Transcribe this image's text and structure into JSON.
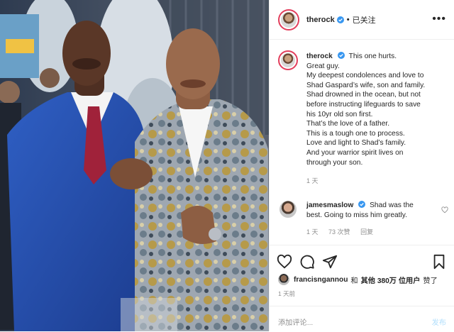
{
  "post": {
    "author": {
      "username": "therock",
      "follow_label": "已关注",
      "separator": "•",
      "verified_icon": "verified-badge-icon",
      "more_icon": "more-options-icon",
      "more_glyph": "•••"
    },
    "photo": {
      "alt_icon": "post-photo"
    },
    "caption": {
      "username": "therock",
      "lines": [
        "This one hurts.",
        "Great guy.",
        "My deepest condolences and love to",
        "Shad Gaspard’s wife, son and family.",
        "Shad drowned in the ocean, but not",
        "before instructing lifeguards to save",
        "his 10yr old son first.",
        "That’s the love of a father.",
        "This is a tough one to process.",
        "Love and light to Shad’s family.",
        "And your warrior spirit lives on",
        "through your son."
      ],
      "time": "1 天"
    },
    "comment": {
      "username": "jamesmaslow",
      "line1": "Shad was the",
      "line2": "best. Going to miss him greatly.",
      "time": "1 天",
      "likes": "73 次赞",
      "reply": "回复"
    },
    "actions": {
      "like_icon": "heart-icon",
      "comment_icon": "comment-icon",
      "share_icon": "share-icon",
      "save_icon": "bookmark-icon"
    },
    "likes": {
      "user": "francisngannou",
      "and": "和",
      "others": "其他 380万 位用户",
      "liked": "赞了"
    },
    "timestamp": "1 天前",
    "add_comment": {
      "placeholder": "添加评论...",
      "post_label": "发布"
    },
    "colors": {
      "link_blue": "#0095f6",
      "post_disabled": "#b2dffc",
      "muted_gray": "#8e8e8e",
      "story_ring": "#e33e5c"
    }
  }
}
